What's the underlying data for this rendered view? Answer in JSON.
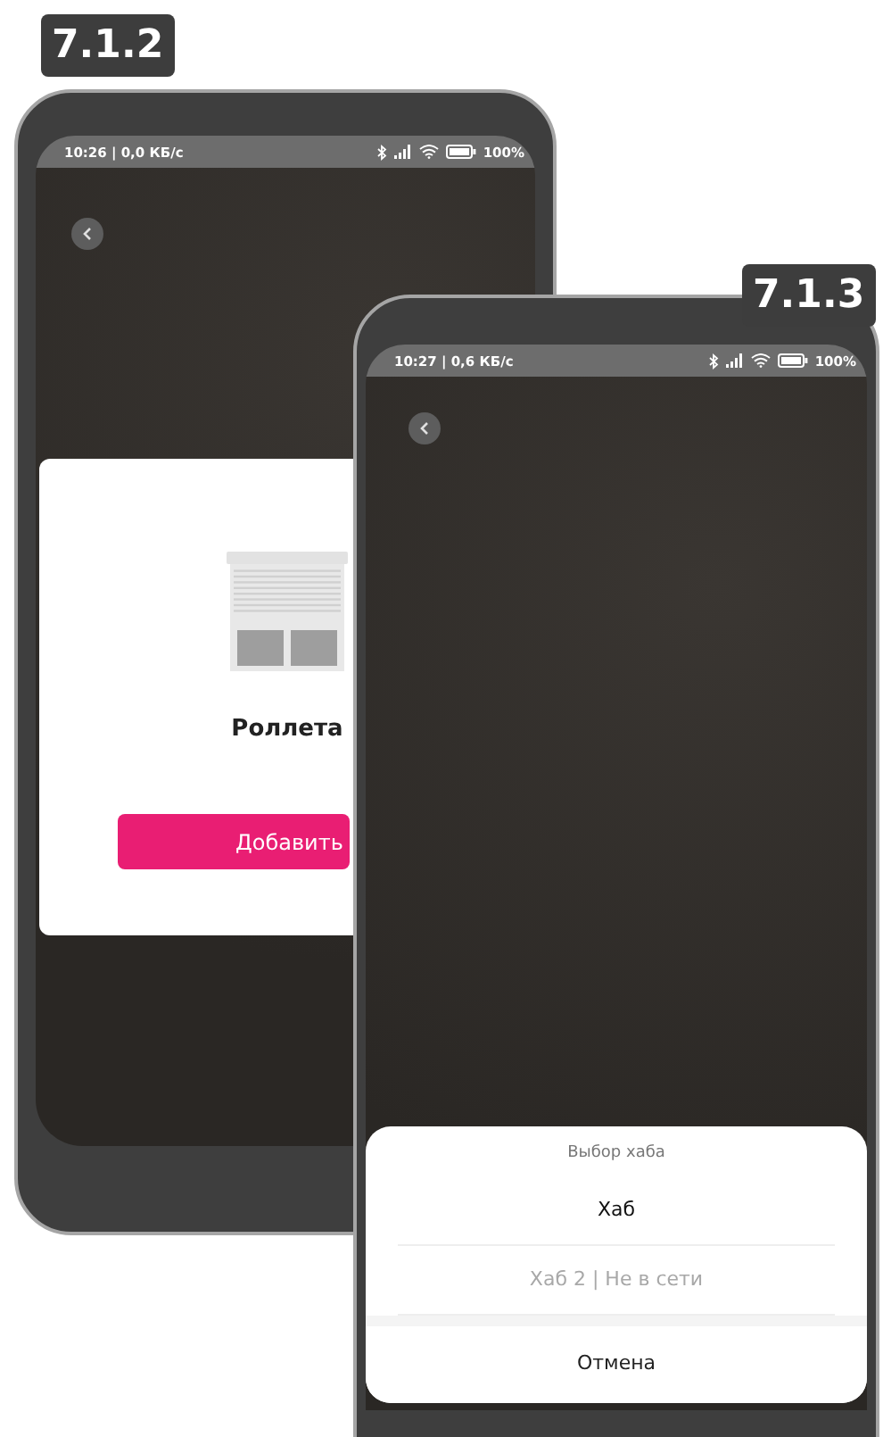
{
  "screens": [
    {
      "kind": "device",
      "label": "7.1.2",
      "status_bar": {
        "time": "10:26 | 0,0 КБ/с",
        "battery": "100%"
      },
      "card": {
        "name": "Роллета",
        "button": "Добавить"
      }
    },
    {
      "kind": "hub_select",
      "label": "7.1.3",
      "status_bar": {
        "time": "10:27 | 0,6 КБ/с",
        "battery": "100%"
      },
      "sheet": {
        "title": "Выбор хаба",
        "options": [
          {
            "label": "Хаб",
            "disabled": false
          },
          {
            "label": "Хаб 2 | Не в сети",
            "disabled": true
          }
        ],
        "cancel": "Отмена"
      }
    }
  ]
}
